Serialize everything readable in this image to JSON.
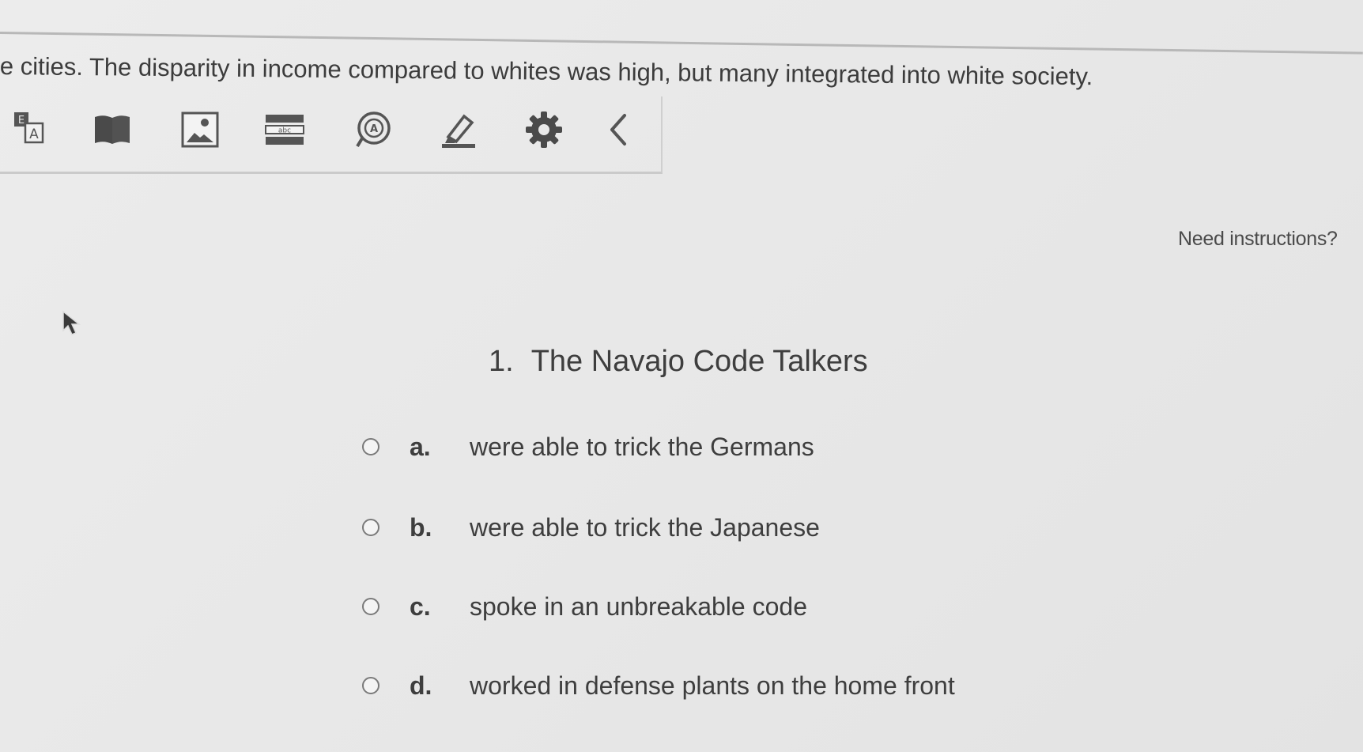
{
  "passage": {
    "text": "e cities.  The disparity in income compared to whites was high, but many integrated into white society."
  },
  "toolbar": {
    "tools": [
      {
        "name": "translate-icon"
      },
      {
        "name": "glossary-book-icon"
      },
      {
        "name": "image-icon"
      },
      {
        "name": "line-reader-icon"
      },
      {
        "name": "text-to-speech-icon"
      },
      {
        "name": "highlighter-icon"
      },
      {
        "name": "settings-gear-icon"
      },
      {
        "name": "collapse-chevron-icon"
      }
    ]
  },
  "help": {
    "label": "Need instructions?"
  },
  "question": {
    "number": "1.",
    "text": "The Navajo Code Talkers",
    "options": [
      {
        "letter": "a.",
        "text": "were able to trick the Germans"
      },
      {
        "letter": "b.",
        "text": "were able to trick the Japanese"
      },
      {
        "letter": "c.",
        "text": "spoke in an unbreakable code"
      },
      {
        "letter": "d.",
        "text": "worked in defense plants on the home front"
      }
    ]
  },
  "colors": {
    "background": "#e6e6e6",
    "text": "#3e3e3e",
    "icon": "#4a4a4a"
  }
}
